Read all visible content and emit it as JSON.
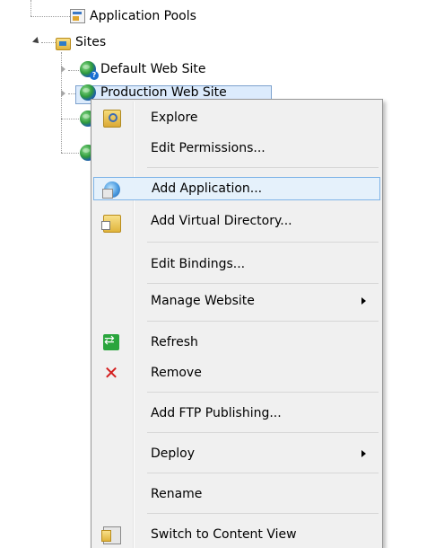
{
  "tree": {
    "application_pools": "Application Pools",
    "sites": "Sites",
    "default_web_site": "Default Web Site",
    "production_web_site": "Production Web Site"
  },
  "context_menu": {
    "items": [
      {
        "label": "Explore",
        "icon": "explore-folder-icon"
      },
      {
        "label": "Edit Permissions...",
        "icon": ""
      },
      {
        "label": "Add Application...",
        "icon": "add-application-icon",
        "highlighted": true
      },
      {
        "label": "Add Virtual Directory...",
        "icon": "add-virtual-directory-icon"
      },
      {
        "label": "Edit Bindings...",
        "icon": ""
      },
      {
        "label": "Manage Website",
        "icon": "",
        "submenu": true
      },
      {
        "label": "Refresh",
        "icon": "refresh-icon"
      },
      {
        "label": "Remove",
        "icon": "remove-x-icon"
      },
      {
        "label": "Add FTP Publishing...",
        "icon": ""
      },
      {
        "label": "Deploy",
        "icon": "",
        "submenu": true
      },
      {
        "label": "Rename",
        "icon": ""
      },
      {
        "label": "Switch to Content View",
        "icon": "content-view-icon"
      }
    ]
  },
  "colors": {
    "menu_bg": "#f0f0f0",
    "highlight_bg": "#e5f1fb",
    "highlight_border": "#7fb4e7",
    "selected_node_bg": "#dcebfc",
    "remove_red": "#d41d1d"
  }
}
